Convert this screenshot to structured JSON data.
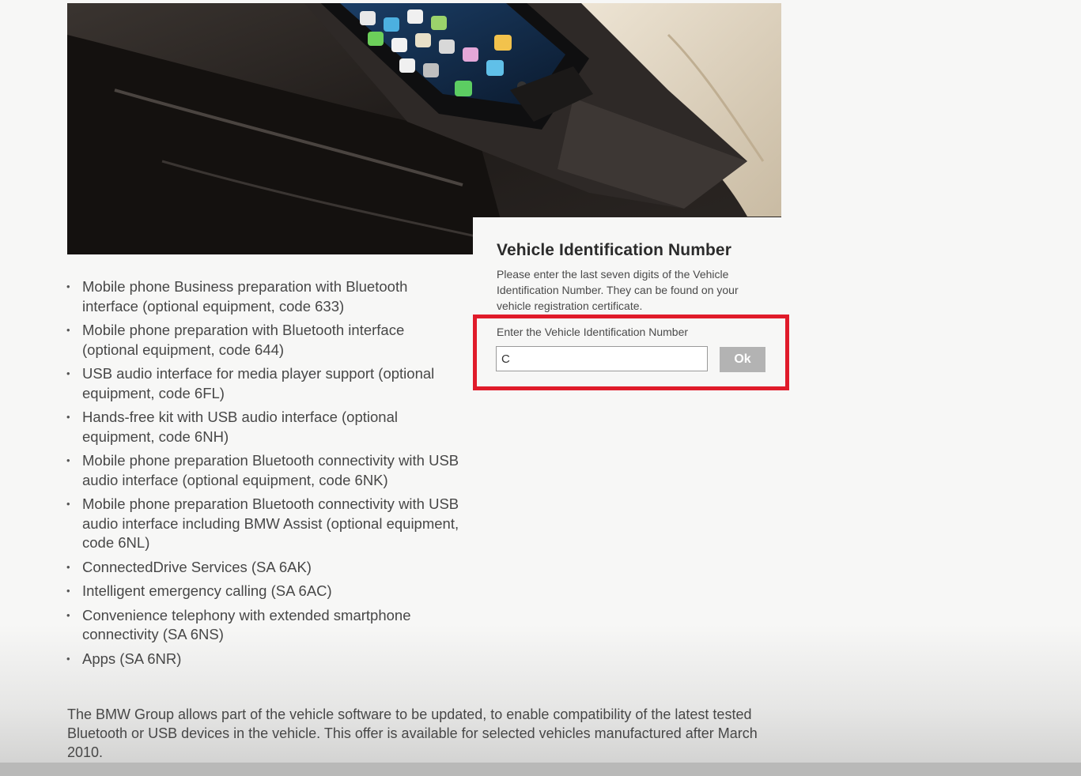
{
  "vin_panel": {
    "title": "Vehicle Identification Number",
    "description": "Please enter the last seven digits of the Vehicle Identification Number. They can be found on your vehicle registration certificate.",
    "field_label": "Enter the Vehicle Identification Number",
    "input_value": "C",
    "ok_label": "Ok",
    "highlight_color": "#e01b2a"
  },
  "features": [
    "Mobile phone Business preparation with Bluetooth interface (optional equipment, code 633)",
    "Mobile phone preparation with Bluetooth interface (optional equipment, code 644)",
    "USB audio interface for media player support (optional equipment, code 6FL)",
    "Hands-free kit with USB audio interface (optional equipment, code 6NH)",
    "Mobile phone preparation Bluetooth connectivity with USB audio interface (optional equipment, code 6NK)",
    "Mobile phone preparation Bluetooth connectivity with USB audio interface including BMW Assist (optional equipment, code 6NL)",
    "ConnectedDrive Services (SA 6AK)",
    "Intelligent emergency calling (SA 6AC)",
    "Convenience telephony with extended smartphone connectivity (SA 6NS)",
    "Apps (SA 6NR)"
  ],
  "bullet_glyph": "•",
  "footer": "The BMW Group allows part of the vehicle software to be updated, to enable compatibility of the latest tested Bluetooth or USB devices in the vehicle. This offer is available for selected vehicles manufactured after March 2010."
}
